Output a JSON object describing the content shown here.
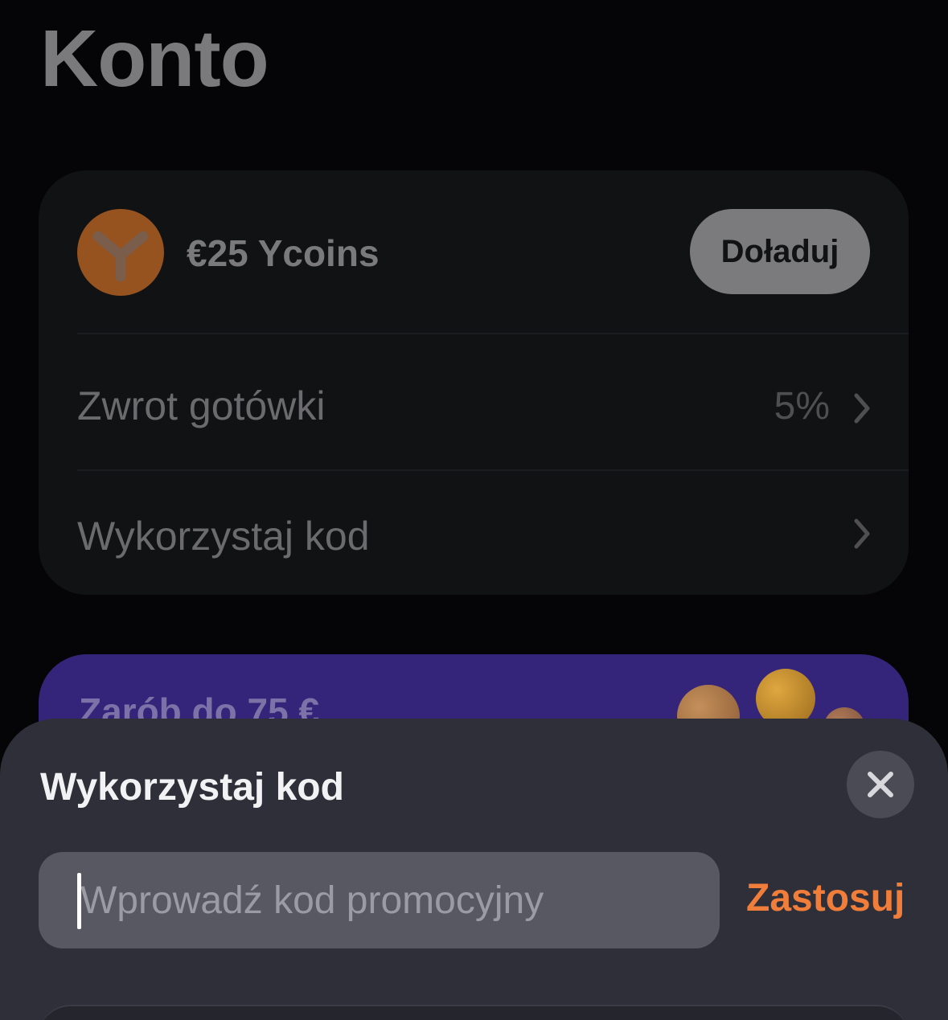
{
  "page": {
    "title": "Konto"
  },
  "account": {
    "balance_label": "€25 Ycoins",
    "topup_label": "Doładuj",
    "rows": [
      {
        "label": "Zwrot gotówki",
        "value": "5%"
      },
      {
        "label": "Wykorzystaj kod",
        "value": ""
      }
    ]
  },
  "promo": {
    "title": "Zarób do 75 €"
  },
  "sheet": {
    "title": "Wykorzystaj kod",
    "input_placeholder": "Wprowadź kod promocyjny",
    "input_value": "",
    "apply_label": "Zastosuj"
  },
  "colors": {
    "accent": "#f07d3a",
    "coin": "#96531f",
    "promo_bg": "#35257a",
    "sheet_bg": "#2e2f38"
  },
  "icons": {
    "coin": "ycoin-logo-icon",
    "chevron": "chevron-right-icon",
    "close": "close-icon"
  }
}
